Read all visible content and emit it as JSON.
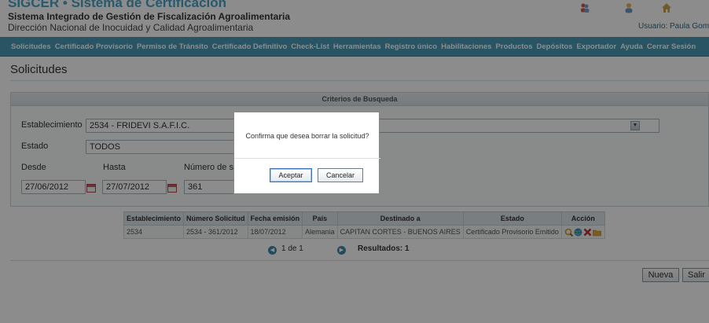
{
  "header": {
    "app_title": "SIGCER • Sistema de Certificación",
    "system_name": "Sistema Integrado de Gestión de Fiscalización Agroalimentaria",
    "directorate": "Dirección Nacional de Inocuidad y Calidad Agroalimentaria",
    "user_label": "Usuario: Paula Gomez",
    "icons": [
      "users-icon",
      "user-icon",
      "home-icon"
    ]
  },
  "menu": {
    "items": [
      "Solicitudes",
      "Certificado Provisorio",
      "Permiso de Tránsito",
      "Certificado Definitivo",
      "Check-List",
      "Herramientas",
      "Registro único",
      "Habilitaciones",
      "Productos",
      "Depósitos",
      "Exportador",
      "Ayuda",
      "Cerrar Sesión"
    ]
  },
  "page": {
    "title": "Solicitudes"
  },
  "search": {
    "panel_title": "Criterios de Busqueda",
    "establecimiento_label": "Establecimiento",
    "establecimiento_value": "2534 - FRIDEVI S.A.F.I.C.",
    "estado_label": "Estado",
    "estado_value": "TODOS",
    "desde_label": "Desde",
    "hasta_label": "Hasta",
    "numero_label": "Número de so",
    "desde_value": "27/06/2012",
    "hasta_value": "27/07/2012",
    "numero_value": "361"
  },
  "results": {
    "columns": [
      "Establecimiento",
      "Número Solicitud",
      "Fecha emisión",
      "País",
      "Destinado a",
      "Estado",
      "Acción"
    ],
    "rows": [
      [
        "2534",
        "2534 - 361/2012",
        "18/07/2012",
        "Alemania",
        "CAPITAN CORTES - BUENOS AIRES",
        "Certificado Provisorio Emitido"
      ]
    ],
    "action_icons": [
      "view-icon",
      "globe-icon",
      "delete-icon",
      "folder-icon"
    ],
    "pager": "1 de 1",
    "summary": "Resultados: 1"
  },
  "buttons": {
    "nueva": "Nueva",
    "salir": "Salir"
  },
  "dialog": {
    "message": "Confirma que desea borrar la solicitud?",
    "accept": "Aceptar",
    "cancel": "Cancelar"
  },
  "colors": {
    "accent": "#4aa3c7",
    "menu_bg": "#4a9ab5"
  }
}
